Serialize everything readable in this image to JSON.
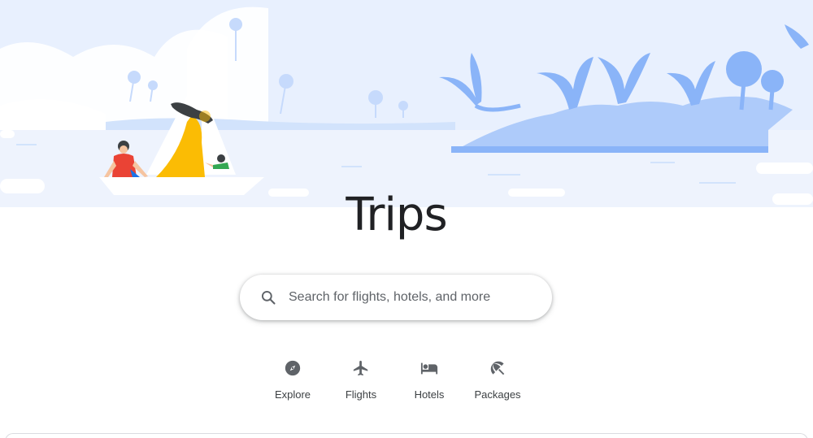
{
  "page": {
    "title": "Trips"
  },
  "search": {
    "placeholder": "Search for flights, hotels, and more",
    "icon": "search-icon"
  },
  "categories": [
    {
      "label": "Explore",
      "icon": "compass-icon"
    },
    {
      "label": "Flights",
      "icon": "airplane-icon"
    },
    {
      "label": "Hotels",
      "icon": "bed-icon"
    },
    {
      "label": "Packages",
      "icon": "beach-umbrella-icon"
    }
  ],
  "colors": {
    "hero_sky": "#e8f0fe",
    "hero_island": "#aecbfa",
    "text_primary": "#202124",
    "text_secondary": "#3c4043",
    "icon_gray": "#5f6368",
    "sailor_shirt": "#ea4335",
    "dress": "#fbbc04",
    "child_shirt": "#34a853"
  }
}
